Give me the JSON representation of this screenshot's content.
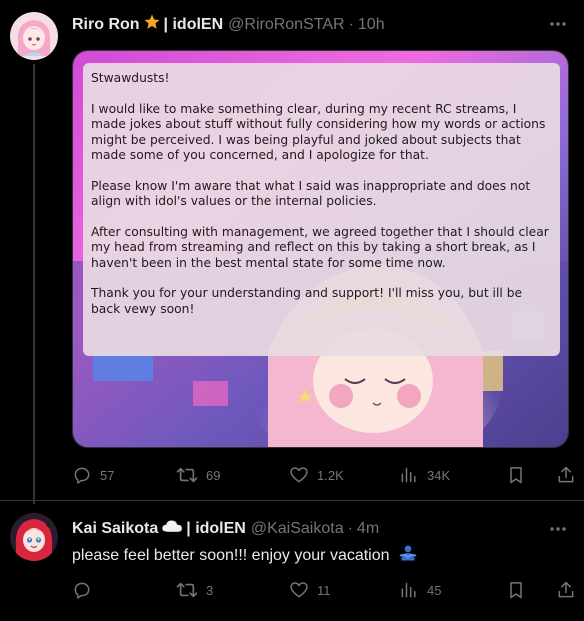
{
  "post": {
    "author_name": "Riro Ron",
    "author_suffix": "| idolEN",
    "handle": "@RiroRonSTAR",
    "separator": "·",
    "time": "10h",
    "badge_icon": "star-icon",
    "media_text": {
      "greeting": "Stwawdusts!",
      "paragraphs": [
        "I would like to make something clear, during my recent RC streams, I made jokes about stuff without fully considering how my words or actions might be perceived. I was being playful and joked about subjects that made some of you concerned, and I apologize for that.",
        "Please know I'm aware that what I said was inappropriate and does not align with idol's values or the internal policies.",
        "After consulting with management, we agreed together that I should clear my head from streaming and reflect on this by taking a short break, as I haven't been in the best mental state for some time now.",
        "Thank you for your understanding and support! I'll miss you, but ill be back vewy soon!"
      ]
    },
    "stats": {
      "replies": "57",
      "reposts": "69",
      "likes": "1.2K",
      "views": "34K"
    }
  },
  "reply": {
    "author_name": "Kai Saikota",
    "author_suffix": "| idolEN",
    "handle": "@KaiSaikota",
    "separator": "·",
    "time": "4m",
    "badge_icon": "cloud-icon",
    "text": "please feel better soon!!! enjoy your vacation",
    "emoji_icon": "hug-icon",
    "stats": {
      "replies": "",
      "reposts": "3",
      "likes": "11",
      "views": "45"
    }
  },
  "colors": {
    "background": "#000000",
    "text": "#e7e9ea",
    "muted": "#71767b",
    "divider": "#2f3336"
  }
}
